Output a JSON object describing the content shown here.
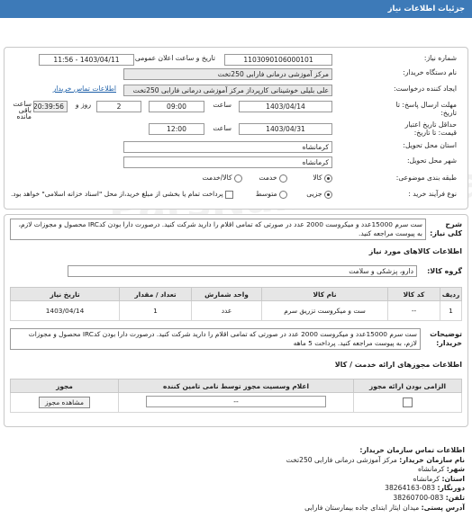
{
  "header": {
    "title": "جزئیات اطلاعات نیاز"
  },
  "form": {
    "need_number_label": "شماره نیاز:",
    "need_number": "1103090106000101",
    "announce_label": "تاریخ و ساعت اعلان عمومی:",
    "announce_value": "1403/04/11 - 11:56",
    "buyer_label": "نام دستگاه خریدار:",
    "buyer_value": "مرکز آموزشی  درمانی فارابی 250تخت",
    "creator_label": "ایجاد کننده درخواست:",
    "creator_value": "علی بلیلی خوشینانی کارپرداز مرکز آموزشی  درمانی فارابی 250تخت",
    "contact_link": "اطلاعات تماس خریدار",
    "deadline_label": "مهلت ارسال پاسخ: تا",
    "deadline_line2": "تاریخ:",
    "deadline_date": "1403/04/14",
    "hour_label": "ساعت",
    "deadline_time": "09:00",
    "days_value": "2",
    "days_label": "روز و",
    "remaining_time": "20:39:56",
    "remaining_label": "ساعت باقی مانده",
    "validity_label": "حداقل تاریخ اعتبار",
    "validity_line2": "قیمت: تا تاریخ:",
    "validity_date": "1403/04/31",
    "validity_time": "12:00",
    "province_label": "استان محل تحویل:",
    "province_value": "کرمانشاه",
    "city_label": "شهر محل تحویل:",
    "city_value": "کرمانشاه",
    "category_label": "طبقه بندی موضوعی:",
    "category_options": [
      "کالا",
      "خدمت",
      "کالا/خدمت"
    ],
    "process_label": "نوع فرآیند خرید :",
    "process_options": [
      "جزیی",
      "متوسط"
    ],
    "process_note": "پرداخت تمام یا بخشی از مبلغ خرید،از محل \"اسناد خزانه اسلامی\" خواهد بود."
  },
  "summary": {
    "label": "شرح کلی نیاز:",
    "text": "ست سرم 15000عدد و میکروست 2000 عدد در صورتی که تمامی اقلام را دارید شرکت کنید. درصورت دارا بودن کدIRC محصول و مجوزات لازم، به پیوست مراجعه کنید."
  },
  "goods": {
    "section_title": "اطلاعات کالاهای مورد نیاز",
    "group_label": "گروه کالا:",
    "group_value": "دارو، پزشکی و سلامت",
    "columns": [
      "ردیف",
      "کد کالا",
      "نام کالا",
      "واحد شمارش",
      "تعداد / مقدار",
      "تاریخ نیاز"
    ],
    "rows": [
      {
        "index": "1",
        "code": "--",
        "name": "ست و میکروست تزریق سرم",
        "unit": "عدد",
        "qty": "1",
        "date": "1403/04/14"
      }
    ]
  },
  "buyer_notes": {
    "label": "توضیحات خریدار:",
    "text": "ست سرم 15000عدد و میکروست 2000 عدد در صورتی که تمامی اقلام را دارید شرکت کنید. درصورت دارا بودن کدIRC محصول و مجوزات لازم، به پیوست مراجعه کنید. پرداخت 5 ماهه"
  },
  "permits": {
    "section_title": "اطلاعات مجوزهای ارائه خدمت / کالا",
    "columns": [
      "الزامی بودن ارائه مجوز",
      "اعلام وسسیت مجوز توسط نامی تامین کننده",
      "مجوز"
    ],
    "row": {
      "value": "--",
      "button": "مشاهده مجوز"
    }
  },
  "org_contact": {
    "title": "اطلاعات تماس سازمان خریدار:",
    "name_label": "نام سازمان خریدار:",
    "name_value": "مرکز آموزشی درمانی فارابی 250تخت",
    "city_label": "شهر:",
    "city_value": "کرمانشاه",
    "province_label": "استان:",
    "province_value": "کرمانشاه",
    "phone_label": "دورنگار:",
    "phone_value": "083-38264163",
    "fax_label": "تلفن:",
    "fax_value": "083-38260700",
    "address_label": "آدرس پستی:",
    "address_value": "میدان ایثار ابتدای جاده بیمارستان فارابی"
  }
}
